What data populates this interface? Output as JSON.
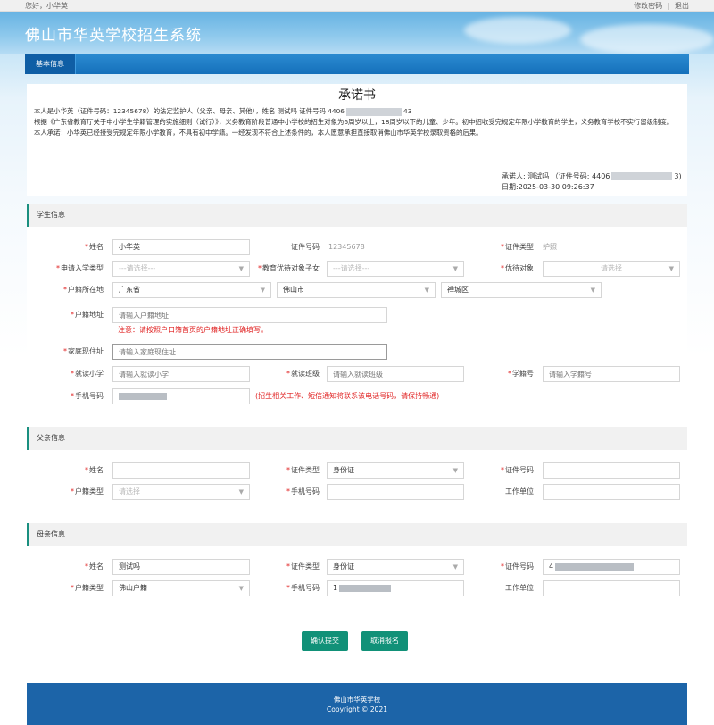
{
  "topbar": {
    "greeting": "您好，小华英",
    "change_password": "修改密码",
    "separator": "|",
    "logout": "退出"
  },
  "header": {
    "title": "佛山市华英学校招生系统"
  },
  "nav": {
    "tab_basic": "基本信息"
  },
  "pledge": {
    "title": "承诺书",
    "line1_a": "本人是小华英（证件号码：12345678）的法定监护人（父亲、母亲、其他），姓名 测试吗 证件号码 4406",
    "line1_b": "43",
    "line2": "根据《广东省教育厅关于中小学生学籍管理的实施细则（试行）》，义务教育阶段普通中小学校的招生对象为6周岁以上，18周岁以下的儿童、少年。初中招收受完规定年限小学教育的学生，义务教育学校不实行留级制度。",
    "line3": "本人承诺：小华英已经接受完规定年限小学教育，不具有初中学籍。一经发现不符合上述条件的，本人愿意承担直接取消佛山市华英学校录取资格的后果。",
    "signer_a": "承诺人: 测试吗 （证件号码: 4406",
    "signer_b": "3)",
    "date": "日期:2025-03-30 09:26:37"
  },
  "student": {
    "header": "学生信息",
    "required_mark": "*",
    "name_label": "姓名",
    "name_value": "小华英",
    "id_number_label": "证件号码",
    "id_number_value": "12345678",
    "id_type_label": "证件类型",
    "id_type_value": "护照",
    "apply_type_label": "申请入学类型",
    "apply_type_placeholder": "---请选择---",
    "edu_priority_label": "教育优待对象子女",
    "edu_priority_placeholder": "---请选择---",
    "priority_label": "优待对象",
    "priority_placeholder": "请选择",
    "hukou_label": "户籍所在地",
    "province": "广东省",
    "city": "佛山市",
    "district": "禅城区",
    "hukou_addr_label": "户籍地址",
    "hukou_addr_placeholder": "请输入户籍地址",
    "hukou_addr_note": "注意：请按照户口簿首页的户籍地址正确填写。",
    "home_addr_label": "家庭现住址",
    "home_addr_placeholder": "请输入家庭现住址",
    "school_label": "就读小学",
    "school_placeholder": "请输入就读小学",
    "class_label": "就读班级",
    "class_placeholder": "请输入就读班级",
    "student_no_label": "学籍号",
    "student_no_placeholder": "请输入学籍号",
    "phone_label": "手机号码",
    "phone_note": "(招生相关工作、短信通知将联系该电话号码，请保持畅通)"
  },
  "father": {
    "header": "父亲信息",
    "name_label": "姓名",
    "id_type_label": "证件类型",
    "id_type_value": "身份证",
    "id_number_label": "证件号码",
    "hukou_type_label": "户籍类型",
    "hukou_type_placeholder": "请选择",
    "phone_label": "手机号码",
    "work_label": "工作单位"
  },
  "mother": {
    "header": "母亲信息",
    "name_label": "姓名",
    "name_value": "测试吗",
    "id_type_label": "证件类型",
    "id_type_value": "身份证",
    "id_number_label": "证件号码",
    "id_number_value": "4",
    "hukou_type_label": "户籍类型",
    "hukou_type_value": "佛山户籍",
    "phone_label": "手机号码",
    "phone_value": "1",
    "work_label": "工作单位"
  },
  "actions": {
    "submit": "确认提交",
    "cancel": "取消报名"
  },
  "footer": {
    "school": "佛山市华英学校",
    "copyright": "Copyright © 2021"
  },
  "colors": {
    "accent_green": "#119178",
    "header_blue": "#1570bb",
    "footer_blue": "#1c64a8",
    "required_red": "#e02020"
  },
  "icons": {
    "select_caret": "chevron-down-icon"
  }
}
